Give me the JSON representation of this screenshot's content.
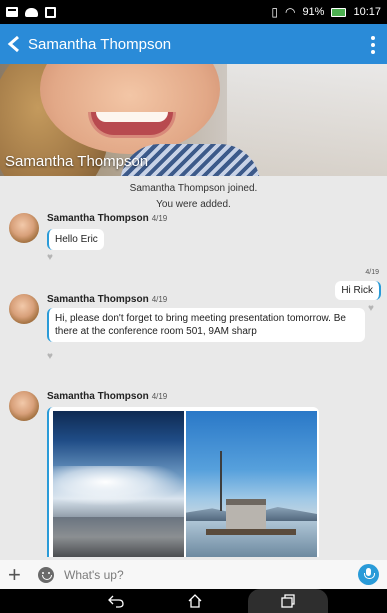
{
  "status_bar": {
    "battery": "91%",
    "time": "10:17"
  },
  "app_bar": {
    "title": "Samantha Thompson"
  },
  "header": {
    "name": "Samantha Thompson"
  },
  "system_messages": [
    "Samantha Thompson joined.",
    "You were added."
  ],
  "messages": [
    {
      "sender": "Samantha Thompson",
      "date": "4/19",
      "text": "Hello Eric"
    },
    {
      "sender": "me",
      "date": "4/19",
      "text": "Hi Rick"
    },
    {
      "sender": "Samantha Thompson",
      "date": "4/19",
      "text": "Hi, please don't forget to bring meeting presentation tomorrow. Be there at the conference room 501, 9AM sharp"
    },
    {
      "sender": "Samantha Thompson",
      "date": "4/19",
      "text": ""
    }
  ],
  "composer": {
    "placeholder": "What's up?"
  },
  "colors": {
    "accent": "#2a8bd8",
    "bubble_accent": "#2a9bd8"
  },
  "icons": [
    "back-arrow-icon",
    "overflow-menu-icon",
    "heart-icon",
    "add-icon",
    "emoji-icon",
    "mic-icon",
    "nav-back-icon",
    "nav-home-icon",
    "nav-recent-icon"
  ]
}
